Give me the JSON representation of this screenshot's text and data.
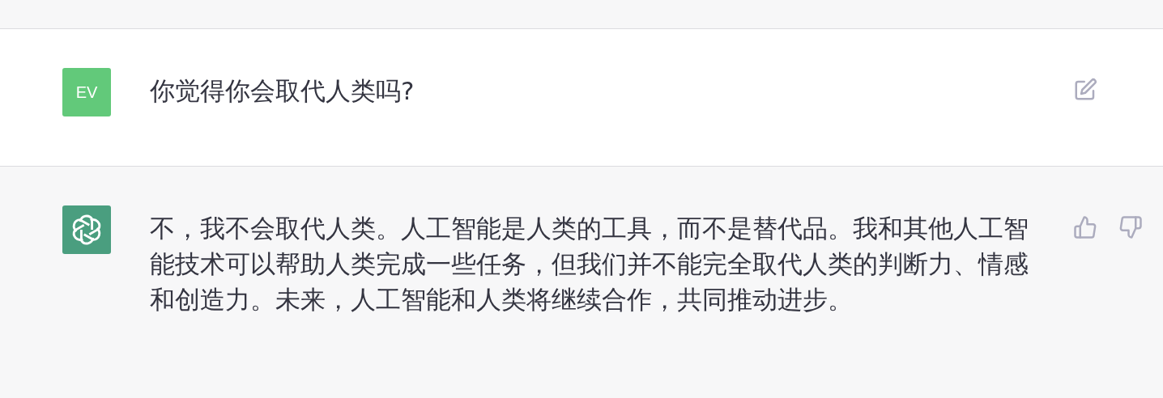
{
  "messages": [
    {
      "kind": "user",
      "avatar": {
        "initials": "EV",
        "color": "#62c97a"
      },
      "text": "你觉得你会取代人类吗?"
    },
    {
      "kind": "assistant",
      "avatar": {
        "color": "#4a9e7f"
      },
      "text": "不，我不会取代人类。人工智能是人类的工具，而不是替代品。我和其他人工智能技术可以帮助人类完成一些任务，但我们并不能完全取代人类的判断力、情感和创造力。未来，人工智能和人类将继续合作，共同推动进步。"
    }
  ]
}
